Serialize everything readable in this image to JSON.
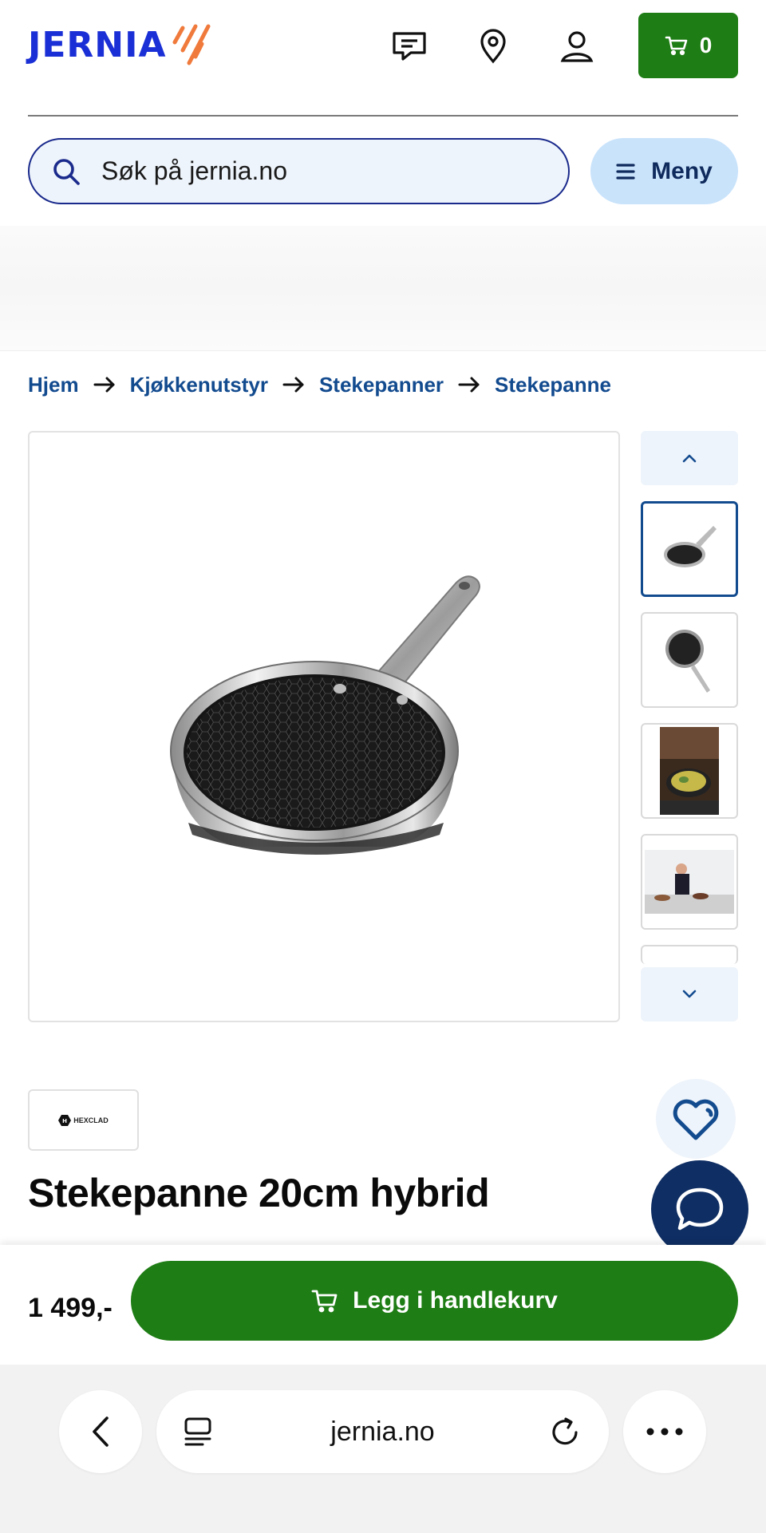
{
  "header": {
    "logo_text": "JERNIA",
    "cart_count": "0",
    "icons": [
      "chat-icon",
      "location-pin-icon",
      "user-icon",
      "cart-icon"
    ],
    "colors": {
      "brand_blue": "#1a2fd6",
      "accent_orange": "#f07a3c",
      "green": "#1e7d14",
      "navy": "#0f2e63"
    }
  },
  "search": {
    "placeholder": "Søk på jernia.no"
  },
  "menu": {
    "label": "Meny"
  },
  "breadcrumbs": [
    "Hjem",
    "Kjøkkenutstyr",
    "Stekepanner",
    "Stekepanne"
  ],
  "product": {
    "brand": "HEXCLAD",
    "title": "Stekepanne 20cm hybrid",
    "price": "1 499,-",
    "add_to_cart_label": "Legg i handlekurv"
  },
  "browser": {
    "url": "jernia.no"
  }
}
